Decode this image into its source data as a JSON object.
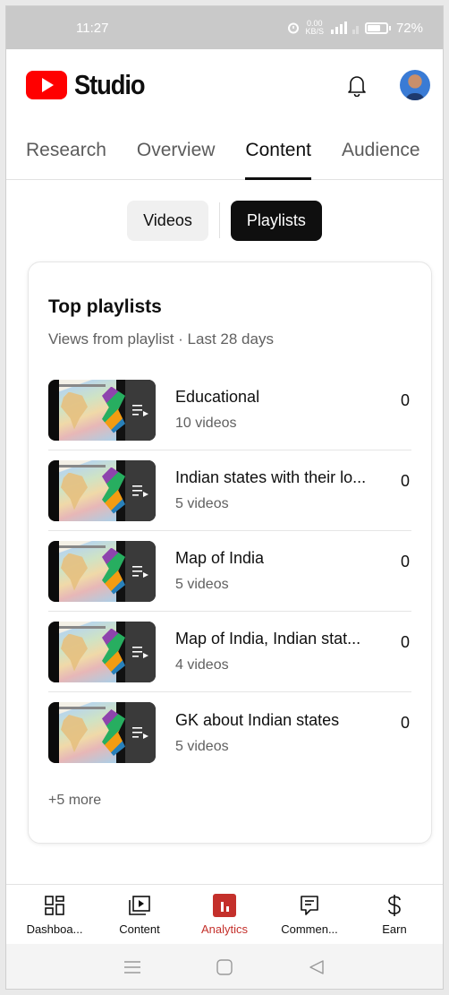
{
  "status_bar": {
    "time": "11:27",
    "network_speed": "0.00",
    "network_unit": "KB/S",
    "battery": "72%"
  },
  "header": {
    "app_name": "Studio",
    "icons": [
      "youtube-logo-icon",
      "bell-icon",
      "avatar"
    ]
  },
  "tabs": [
    {
      "label": "Research",
      "active": false
    },
    {
      "label": "Overview",
      "active": false
    },
    {
      "label": "Content",
      "active": true
    },
    {
      "label": "Audience",
      "active": false
    }
  ],
  "chips": [
    {
      "label": "Videos",
      "selected": false
    },
    {
      "label": "Playlists",
      "selected": true
    }
  ],
  "card": {
    "title": "Top playlists",
    "subtitle": "Views from playlist · Last 28 days",
    "playlists": [
      {
        "name": "Educational",
        "count": "10 videos",
        "views": "0"
      },
      {
        "name": "Indian states with their lo...",
        "count": "5 videos",
        "views": "0"
      },
      {
        "name": "Map of India",
        "count": "5 videos",
        "views": "0"
      },
      {
        "name": "Map of India, Indian stat...",
        "count": "4 videos",
        "views": "0"
      },
      {
        "name": "GK about Indian states",
        "count": "5 videos",
        "views": "0"
      }
    ],
    "more": "+5 more"
  },
  "bottom_nav": [
    {
      "label": "Dashboa...",
      "icon": "dashboard-icon",
      "active": false
    },
    {
      "label": "Content",
      "icon": "content-icon",
      "active": false
    },
    {
      "label": "Analytics",
      "icon": "analytics-icon",
      "active": true
    },
    {
      "label": "Commen...",
      "icon": "comments-icon",
      "active": false
    },
    {
      "label": "Earn",
      "icon": "earn-icon",
      "active": false
    }
  ],
  "colors": {
    "accent": "#c4302b",
    "youtube_red": "#ff0000",
    "text": "#0f0f0f",
    "muted": "#606060"
  }
}
